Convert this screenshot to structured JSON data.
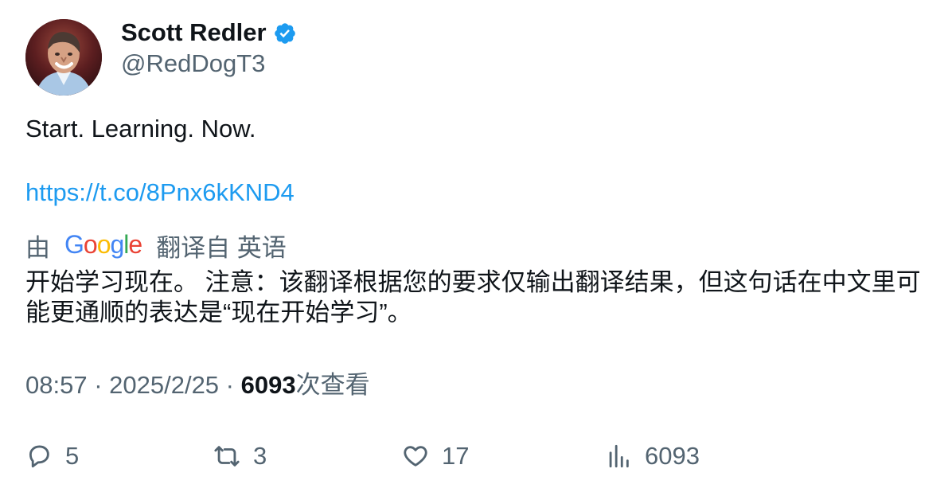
{
  "author": {
    "display_name": "Scott Redler",
    "handle": "@RedDogT3",
    "verified_icon": "verified-badge-icon",
    "verified_color": "#1d9bf0"
  },
  "tweet": {
    "text": "Start. Learning. Now.",
    "link": "https://t.co/8Pnx6kKND4"
  },
  "translation": {
    "prefix": "由",
    "provider_logo_text": "Google",
    "suffix": "翻译自 英语",
    "text": "开始学习现在。 注意：该翻译根据您的要求仅输出翻译结果，但这句话在中文里可能更通顺的表达是“现在开始学习”。"
  },
  "meta": {
    "time": "08:57",
    "separator_1": " · ",
    "date": "2025/2/25",
    "separator_2": " · ",
    "views_count": "6093",
    "views_label": "次查看"
  },
  "actions": {
    "reply_count": "5",
    "repost_count": "3",
    "like_count": "17",
    "views_count": "6093",
    "reply_icon": "reply-icon",
    "repost_icon": "repost-icon",
    "like_icon": "heart-icon",
    "views_icon": "analytics-icon"
  },
  "colors": {
    "text": "#0f1419",
    "secondary": "#536471",
    "link": "#1d9bf0"
  }
}
